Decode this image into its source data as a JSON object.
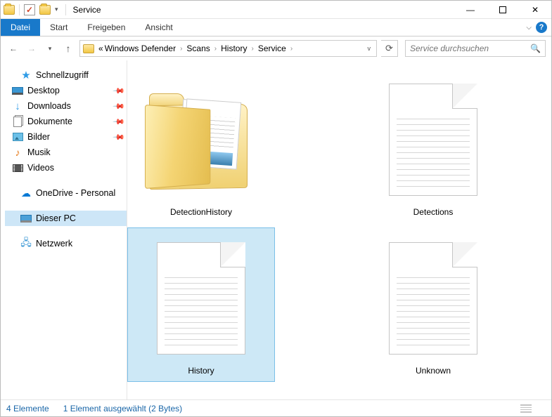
{
  "window": {
    "title": "Service"
  },
  "ribbon": {
    "file": "Datei",
    "tabs": [
      "Start",
      "Freigeben",
      "Ansicht"
    ]
  },
  "address": {
    "prefix": "«",
    "crumbs": [
      "Windows Defender",
      "Scans",
      "History",
      "Service"
    ]
  },
  "search": {
    "placeholder": "Service durchsuchen"
  },
  "sidebar": {
    "quickaccess": {
      "label": "Schnellzugriff"
    },
    "qa_items": [
      {
        "label": "Desktop",
        "icon": "desktop",
        "pinned": true
      },
      {
        "label": "Downloads",
        "icon": "downloads",
        "pinned": true
      },
      {
        "label": "Dokumente",
        "icon": "docs",
        "pinned": true
      },
      {
        "label": "Bilder",
        "icon": "pics",
        "pinned": true
      },
      {
        "label": "Musik",
        "icon": "music",
        "pinned": false
      },
      {
        "label": "Videos",
        "icon": "video",
        "pinned": false
      }
    ],
    "onedrive": {
      "label": "OneDrive - Personal"
    },
    "thispc": {
      "label": "Dieser PC"
    },
    "network": {
      "label": "Netzwerk"
    }
  },
  "items": [
    {
      "name": "DetectionHistory",
      "type": "folder-preview",
      "selected": false
    },
    {
      "name": "Detections",
      "type": "file",
      "selected": false
    },
    {
      "name": "History",
      "type": "file",
      "selected": true
    },
    {
      "name": "Unknown",
      "type": "file",
      "selected": false
    }
  ],
  "status": {
    "count": "4 Elemente",
    "selection": "1 Element ausgewählt (2 Bytes)"
  }
}
